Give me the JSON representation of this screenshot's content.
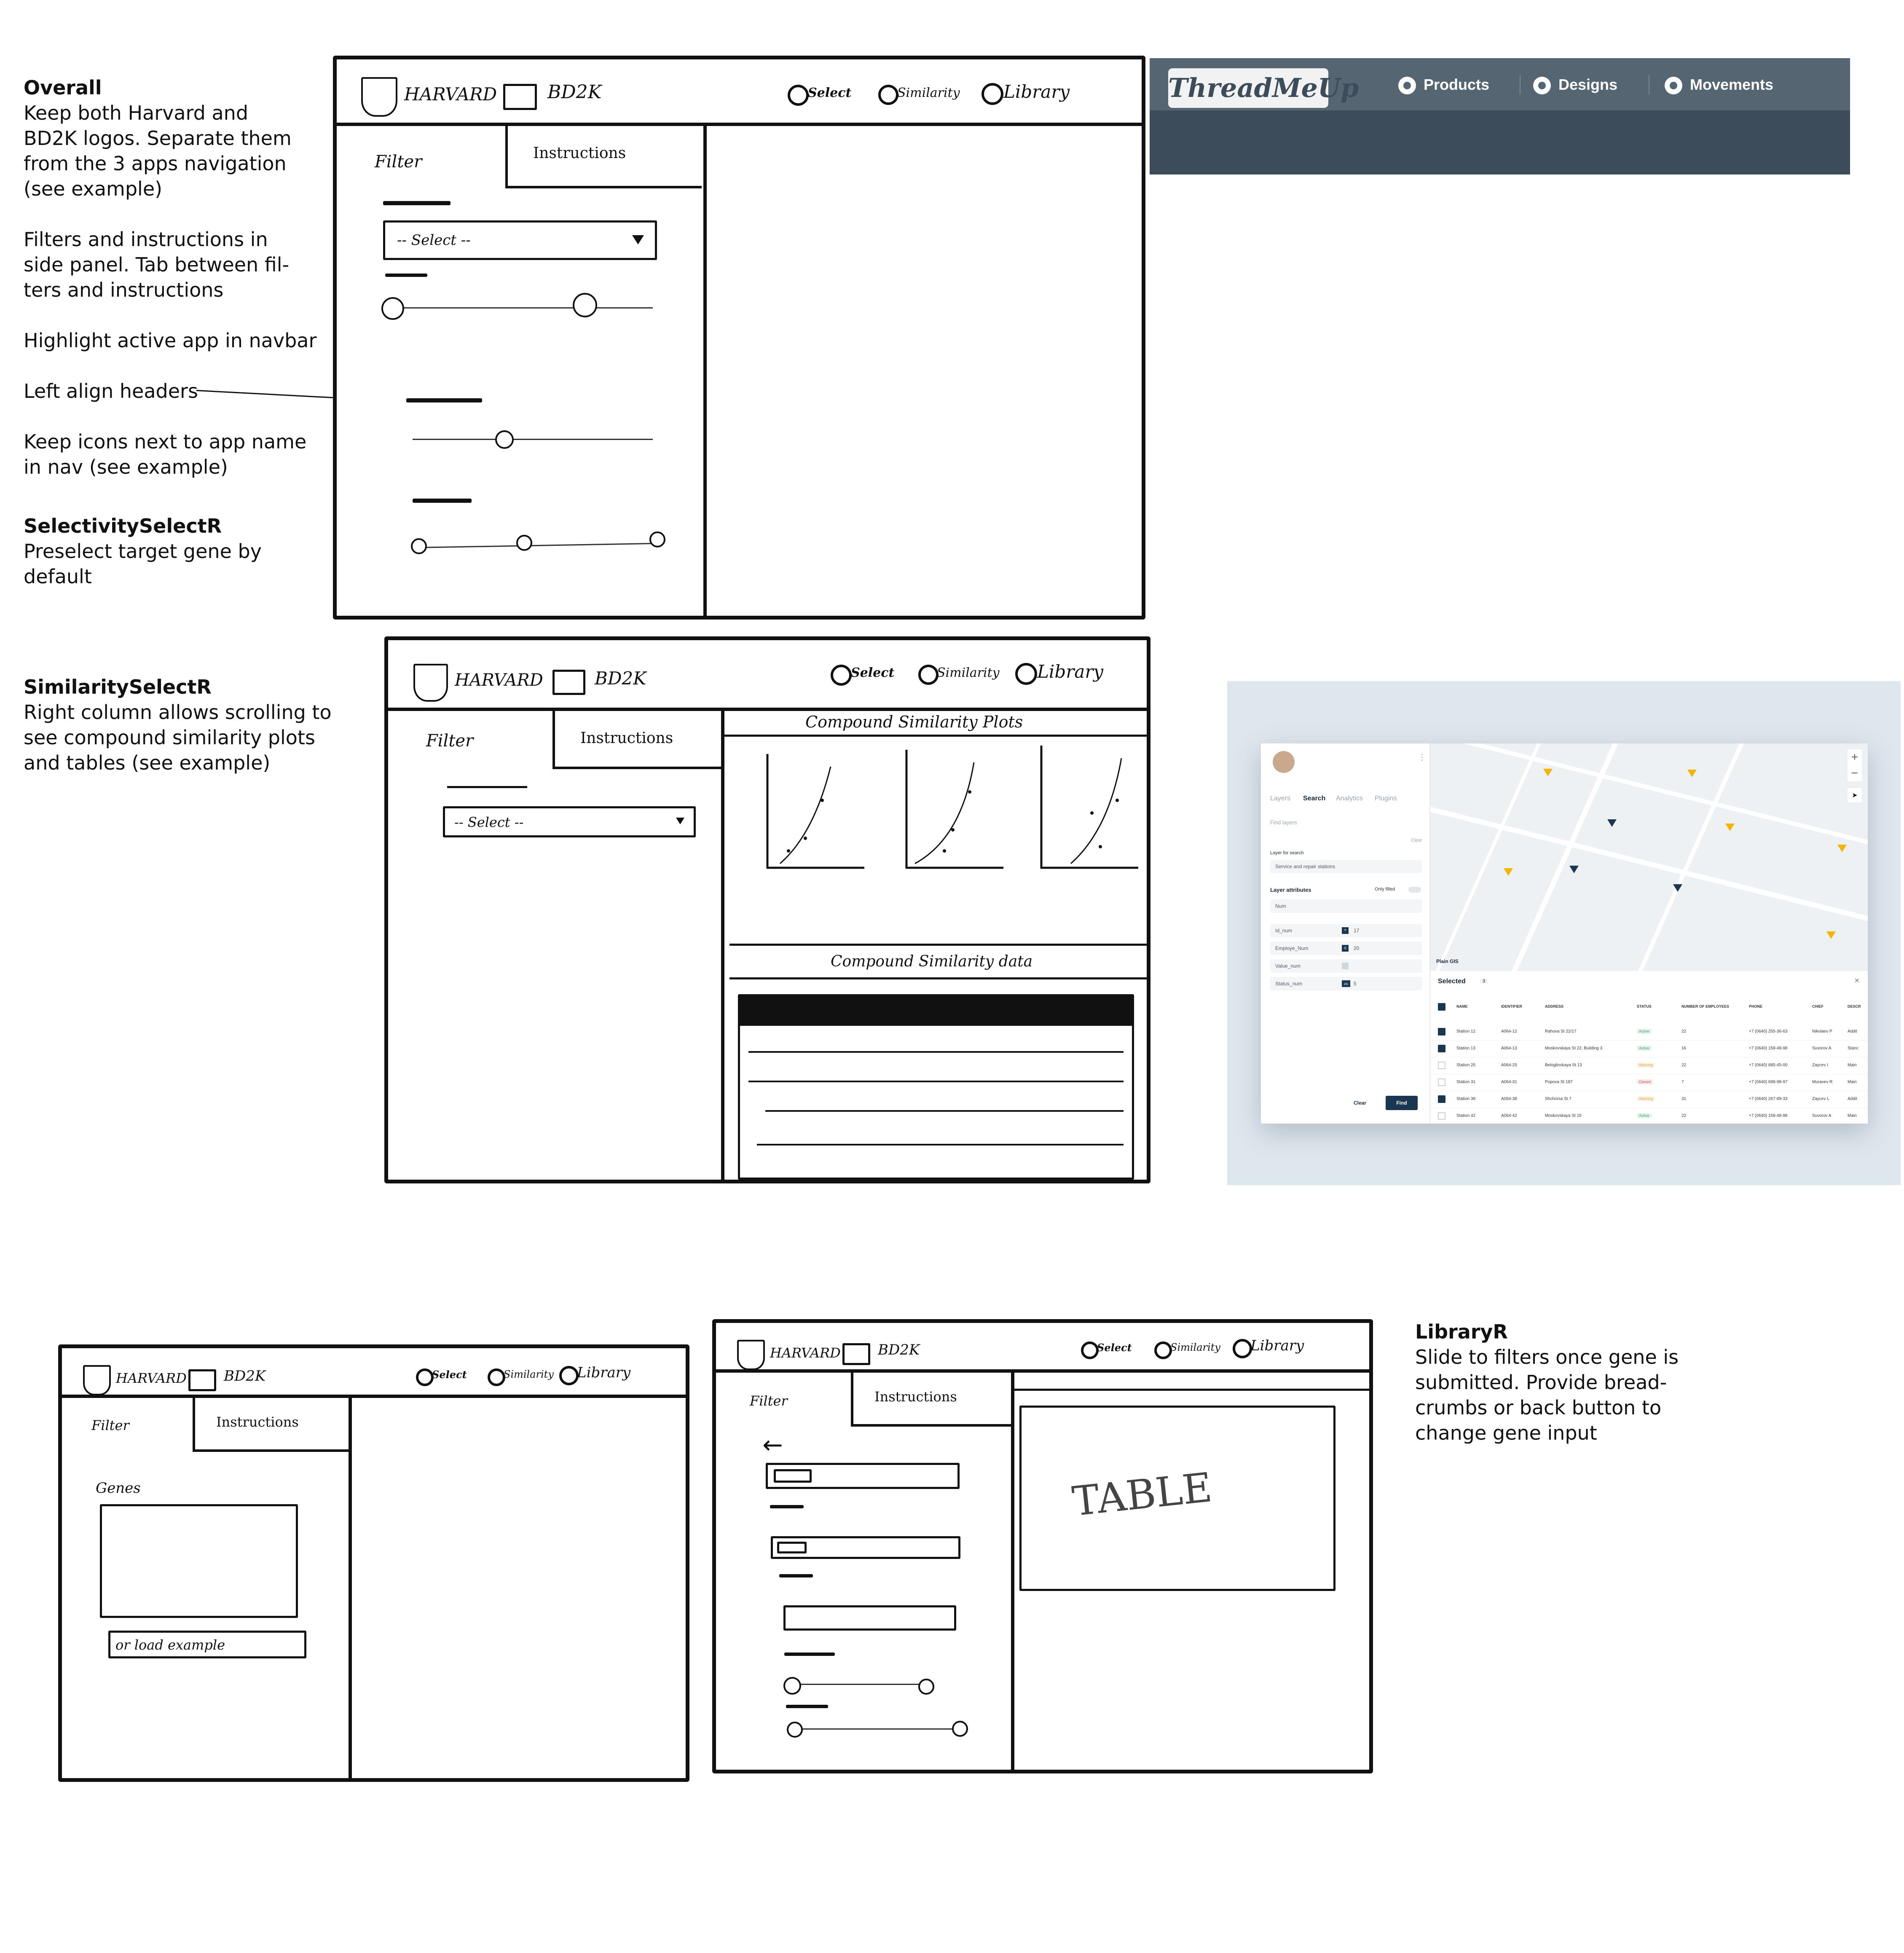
{
  "notes": {
    "overall": {
      "title": "Overall",
      "p1": [
        "Keep both Harvard and",
        "BD2K logos. Separate them",
        "from the 3 apps navigation",
        "(see example)"
      ],
      "p2": [
        "Filters and instructions in",
        "side panel. Tab between fil-",
        "ters and instructions"
      ],
      "p3": [
        "Highlight active app in navbar"
      ],
      "p4": [
        "Left align headers"
      ],
      "p5": [
        "Keep icons next to app name",
        "in nav (see example)"
      ]
    },
    "selectivity": {
      "title": "SelectivitySelectR",
      "lines": [
        "Preselect target gene by default"
      ]
    },
    "similarity": {
      "title": "SimilaritySelectR",
      "lines": [
        "Right column allows scrolling to",
        "see compound similarity plots",
        "and tables (see example)"
      ]
    },
    "library": {
      "title": "LibraryR",
      "lines": [
        "Slide to filters once gene is",
        "submitted. Provide bread-",
        "crumbs or back button to",
        "change gene input"
      ]
    }
  },
  "sketch": {
    "harvard": "HARVARD",
    "bd2k": "BD2K",
    "nav": [
      "Select",
      "Similarity",
      "Library"
    ],
    "filter_tab": "Filter",
    "instructions_tab": "Instructions",
    "select_placeholder": "-- Select --",
    "plots_title": "Compound Similarity Plots",
    "data_title": "Compound Similarity data",
    "genes_label": "Genes",
    "load_example": "or load example",
    "table_label": "TABLE"
  },
  "threadmeup": {
    "logo": "ThreadMeUp",
    "nav": [
      "Products",
      "Designs",
      "Movements"
    ],
    "colors": {
      "bar": "#566572",
      "body": "#3c4c5a"
    }
  },
  "map_example": {
    "tabs": [
      "Layers",
      "Search",
      "Analytics",
      "Plugins"
    ],
    "search_placeholder": "Find layers",
    "clear_label": "Clear",
    "layer_for_search_label": "Layer for search",
    "layer_value": "Service and repair stations",
    "layer_attributes": "Layer attributes",
    "only_filled": "Only filled",
    "num_field": "Num",
    "attributes": [
      {
        "name": "Id_num",
        "op": ">",
        "value": "17"
      },
      {
        "name": "Employe_Num",
        "op": "≤",
        "value": "20"
      },
      {
        "name": "Value_num",
        "op": "",
        "value": ""
      },
      {
        "name": "Status_num",
        "op": "≥≤",
        "value": "5"
      }
    ],
    "buttons": {
      "clear": "Clear",
      "find": "Find"
    },
    "map_brand": "Plain GIS",
    "selected_title": "Selected",
    "selected_count": "3",
    "columns": [
      "NAME",
      "IDENTIFIER",
      "ADDRESS",
      "STATUS",
      "NUMBER OF EMPLOYEES",
      "PHONE",
      "CHIEF",
      "DESCR"
    ],
    "rows": [
      {
        "checked": true,
        "name": "Station 12",
        "id": "A064-12",
        "address": "Rahova St 22/17",
        "status": "Active",
        "employees": "22",
        "phone": "+7 (0640) 255-36-63",
        "chief": "Nikolaev P",
        "desc": "Addit"
      },
      {
        "checked": true,
        "name": "Station 13",
        "id": "A064-13",
        "address": "Moskovskaya St 22, Building 3",
        "status": "Active",
        "employees": "16",
        "phone": "+7 (0640) 158-48-98",
        "chief": "Suvorov A",
        "desc": "Stanc"
      },
      {
        "checked": false,
        "name": "Station 25",
        "id": "A064-25",
        "address": "Beloglinskaya St 13",
        "status": "Warning",
        "employees": "22",
        "phone": "+7 (0640) 685-45-00",
        "chief": "Zaycev I",
        "desc": "Main"
      },
      {
        "checked": false,
        "name": "Station 31",
        "id": "A064-31",
        "address": "Popova St 187",
        "status": "Closed",
        "employees": "7",
        "phone": "+7 (0640) 698-98-97",
        "chief": "Muravev R",
        "desc": "Main"
      },
      {
        "checked": true,
        "name": "Station 38",
        "id": "A064-38",
        "address": "Shchorsa St 7",
        "status": "Warning",
        "employees": "31",
        "phone": "+7 (0640) 267-89-33",
        "chief": "Zaycev L",
        "desc": "Addit"
      },
      {
        "checked": false,
        "name": "Station 42",
        "id": "A064-42",
        "address": "Moskovskaya St 15",
        "status": "Active",
        "employees": "22",
        "phone": "+7 (0640) 158-48-98",
        "chief": "Suvorov A",
        "desc": "Main"
      }
    ],
    "status_colors": {
      "Active": "#3aa76d",
      "Warning": "#e6a23c",
      "Closed": "#e05252"
    }
  }
}
